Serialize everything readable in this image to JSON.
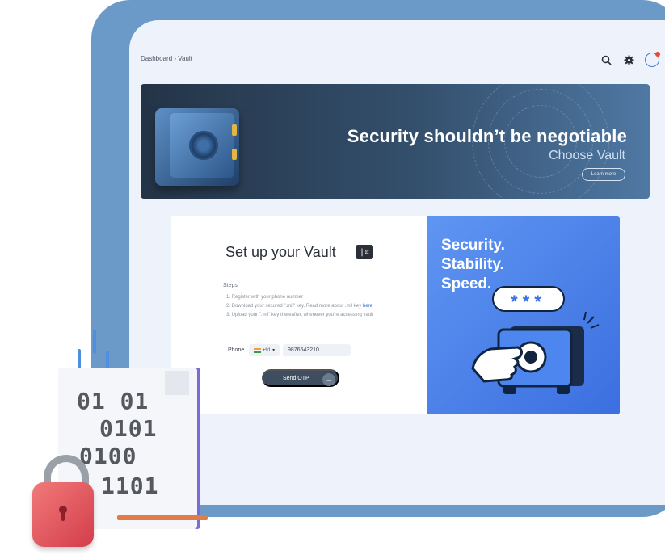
{
  "header": {
    "breadcrumb": "Dashboard › Vault",
    "icons": [
      "search-icon",
      "gear-icon",
      "notification-icon"
    ]
  },
  "banner": {
    "title": "Security shouldn’t be negotiable",
    "subtitle": "Choose Vault",
    "learn_more": "Learn more"
  },
  "setup": {
    "title": "Set up your Vault",
    "badge": "|¤",
    "steps_heading": "Steps",
    "steps": [
      "1. Register with your phone number",
      "2. Download your secured \".mil\" key. Read more about .mil key",
      "3. Upload your \".mil\" key thereafter, whenever you're accessing vault"
    ],
    "here_link": "here",
    "phone_label": "Phone",
    "country_code": "+91",
    "phone_value": "9876543210",
    "send_otp": "Send OTP"
  },
  "promo": {
    "line1": "Security.",
    "line2": "Stability.",
    "line3": "Speed.",
    "bubble": "***"
  },
  "decor": {
    "binary_rows": [
      "01 01",
      "0101",
      "0100",
      "1101"
    ]
  },
  "colors": {
    "accent": "#3b6fe0",
    "banner_dark": "#243447",
    "frame": "#6c9ac8"
  }
}
